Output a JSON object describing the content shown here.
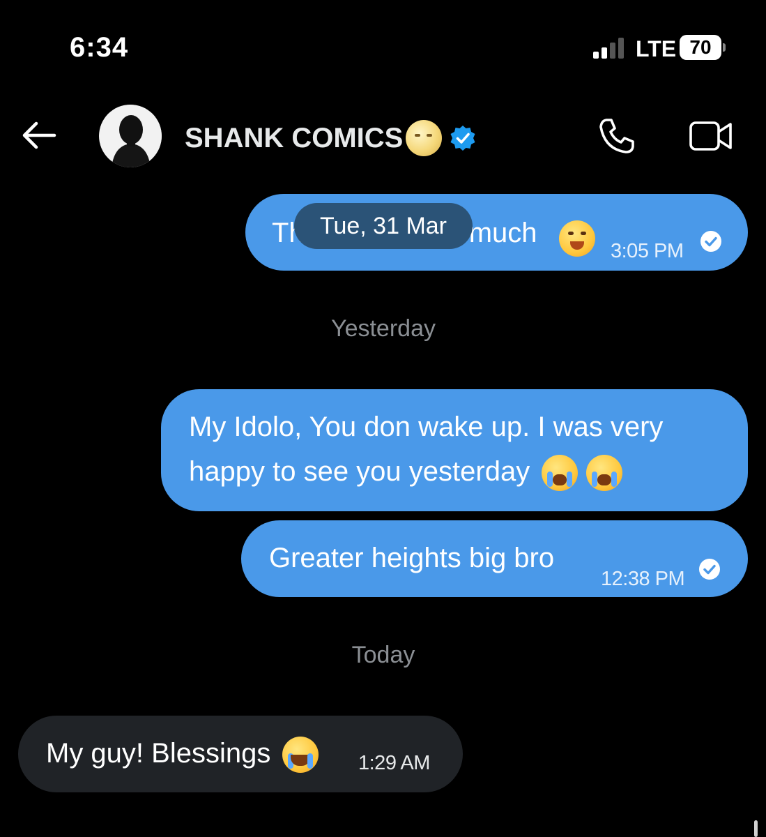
{
  "status_bar": {
    "time": "6:34",
    "network": "LTE",
    "battery": "70"
  },
  "header": {
    "contact_name": "SHANK COMICS",
    "icons": {
      "back": "back-arrow-icon",
      "call": "phone-icon",
      "video": "video-camera-icon",
      "verified": "verified-badge-icon",
      "name_emoji": "full-moon-face-emoji"
    }
  },
  "floating_date": "Tue, 31 Mar",
  "messages": [
    {
      "direction": "outgoing",
      "text": "Th",
      "text_tail": "much",
      "emoji": "smiling-face-emoji",
      "time": "3:05 PM",
      "read": true
    },
    {
      "type": "separator",
      "label": "Yesterday"
    },
    {
      "direction": "outgoing",
      "text": "My Idolo, You don wake up. I was very happy to see you yesterday",
      "emoji": "loudly-crying-face-emoji"
    },
    {
      "direction": "outgoing",
      "text": "Greater heights big bro",
      "time": "12:38 PM",
      "read": true
    },
    {
      "type": "separator",
      "label": "Today"
    },
    {
      "direction": "incoming",
      "text": "My guy! Blessings",
      "emoji": "face-with-tears-of-joy-emoji",
      "time": "1:29 AM"
    }
  ],
  "colors": {
    "outgoing_bubble": "#4a99e9",
    "incoming_bubble": "#202327",
    "background": "#000000",
    "verified": "#1d9bf0"
  }
}
